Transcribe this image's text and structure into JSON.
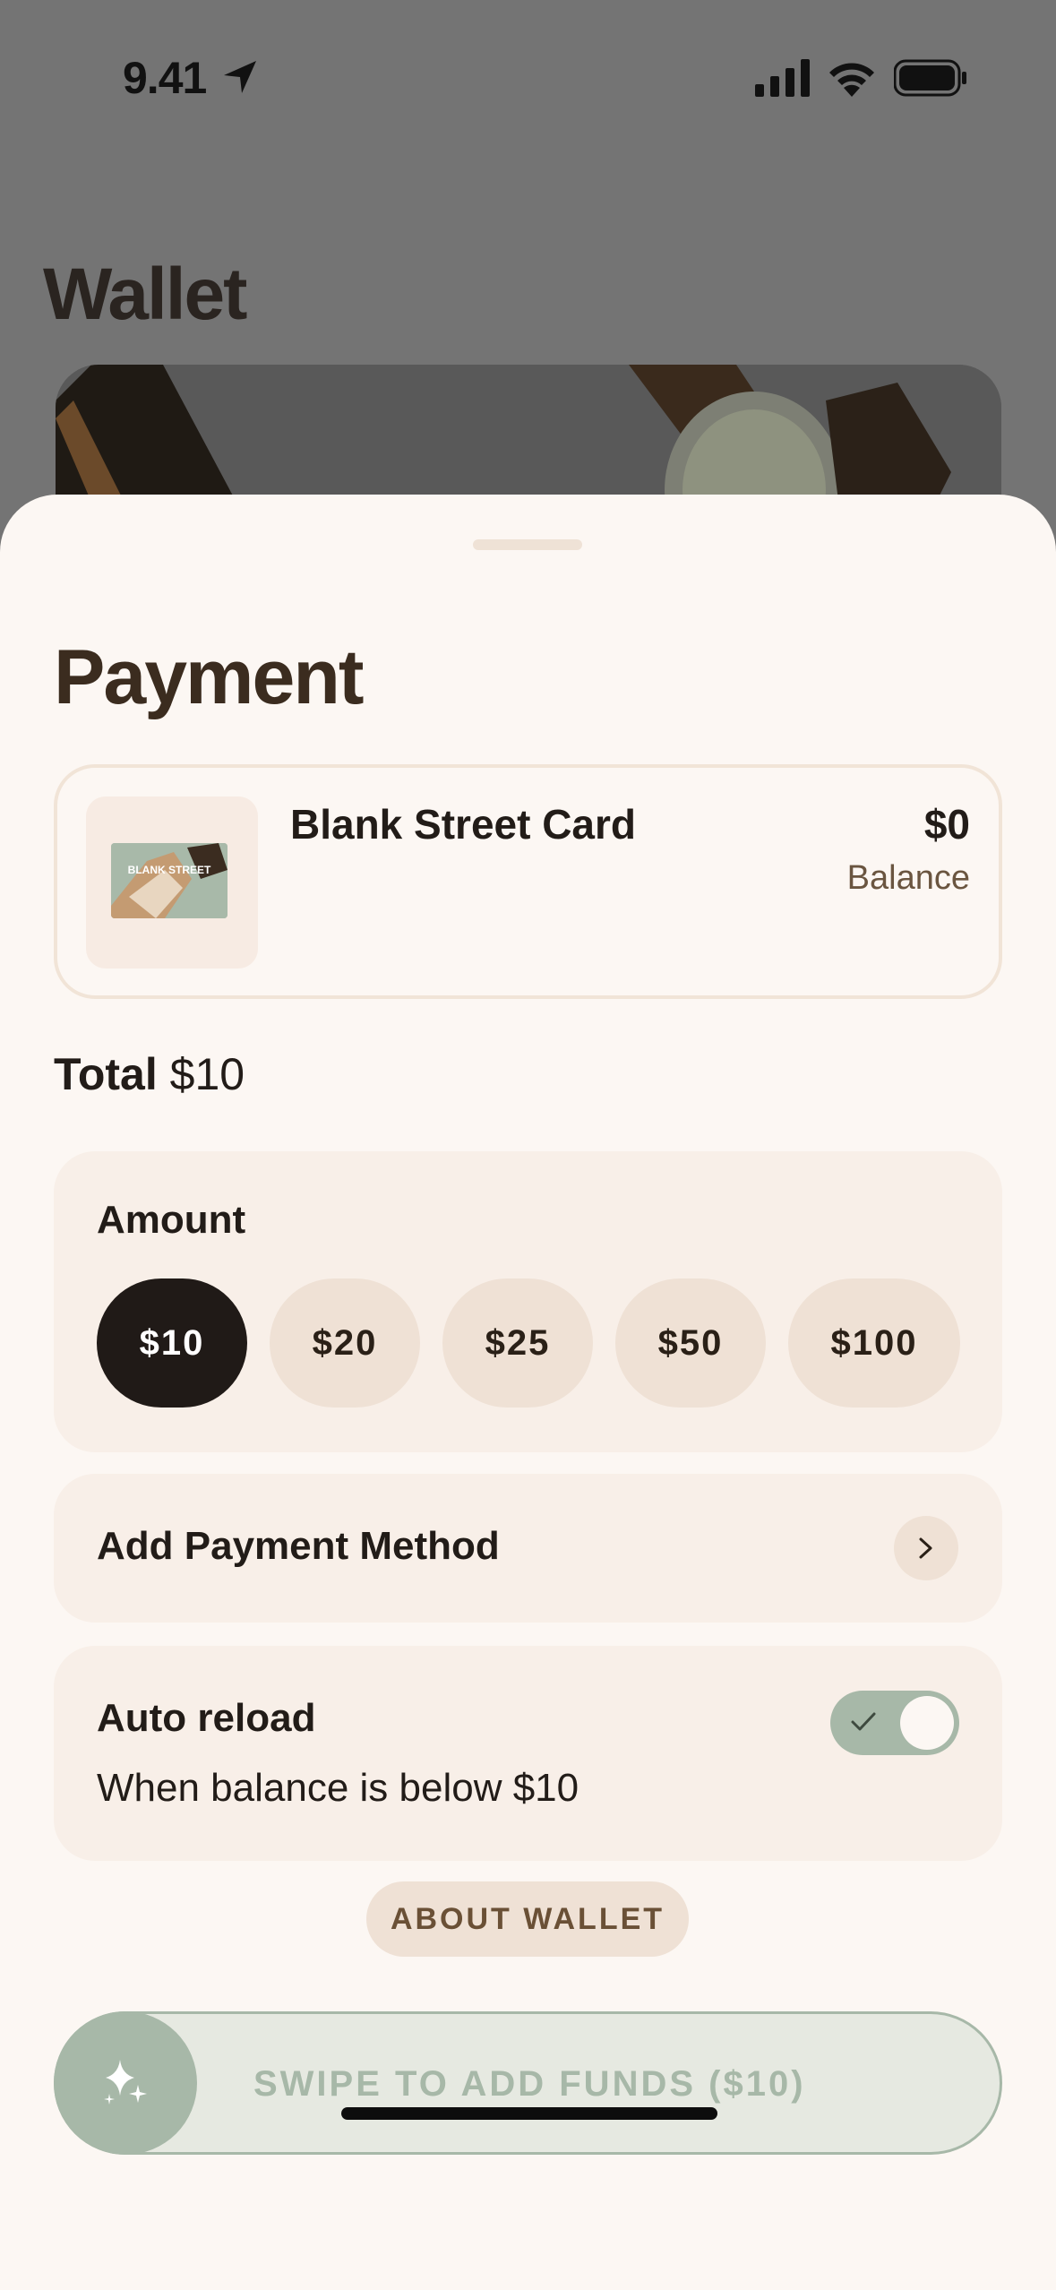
{
  "status_bar": {
    "time": "9.41"
  },
  "background": {
    "title": "Wallet"
  },
  "sheet": {
    "title": "Payment",
    "card": {
      "name": "Blank Street Card",
      "balance": "$0",
      "balance_label": "Balance",
      "thumb_text": "BLANK STREET"
    },
    "total": {
      "label": "Total",
      "value": "$10"
    },
    "amount": {
      "label": "Amount",
      "options": [
        "$10",
        "$20",
        "$25",
        "$50",
        "$100"
      ],
      "selected": "$10"
    },
    "payment_method": {
      "label": "Add Payment Method"
    },
    "auto_reload": {
      "label": "Auto reload",
      "subtitle": "When balance is below $10",
      "enabled": true
    },
    "about_button": "ABOUT WALLET",
    "swipe_label": "SWIPE TO ADD FUNDS ($10)"
  },
  "colors": {
    "accent_sage": "#a7b8a8",
    "selected_dark": "#201a17",
    "pill_beige": "#efe1d5",
    "title_brown": "#3b2c1f"
  }
}
